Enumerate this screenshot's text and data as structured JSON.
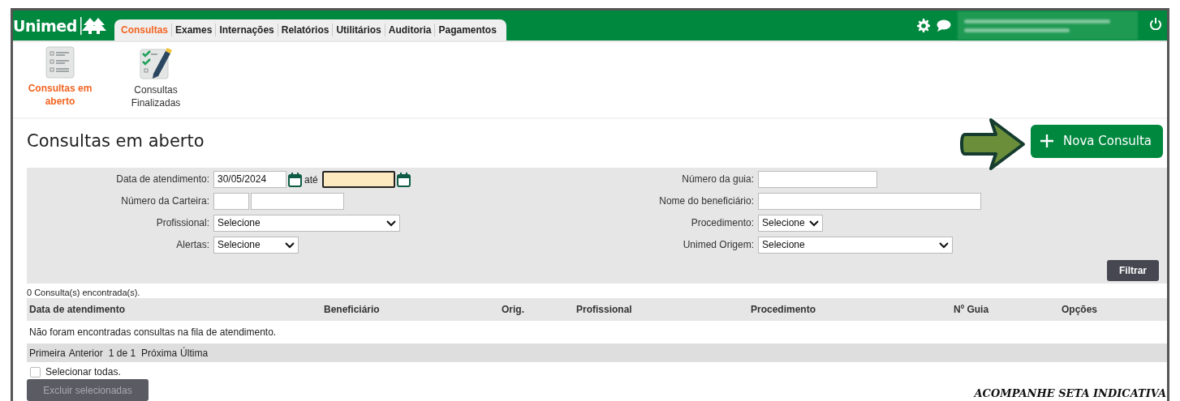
{
  "header": {
    "logo": "Unimed",
    "tabs": [
      {
        "label": "Consultas",
        "selected": true
      },
      {
        "label": "Exames",
        "selected": false
      },
      {
        "label": "Internações",
        "selected": false
      },
      {
        "label": "Relatórios",
        "selected": false
      },
      {
        "label": "Utilitários",
        "selected": false
      },
      {
        "label": "Auditoria",
        "selected": false
      },
      {
        "label": "Pagamentos",
        "selected": false
      }
    ]
  },
  "subnav": [
    {
      "label": "Consultas em aberto",
      "kind": "open",
      "selected": true
    },
    {
      "label": "Consultas Finalizadas",
      "kind": "done",
      "selected": false
    }
  ],
  "page_title": "Consultas em aberto",
  "new_button": "Nova Consulta",
  "filters": {
    "left": [
      {
        "label": "Data de atendimento:",
        "kind": "daterange",
        "value": "30/05/2024",
        "separator": "até",
        "end_focused": true
      },
      {
        "label": "Número da Carteira:",
        "kind": "split"
      },
      {
        "label": "Profissional:",
        "kind": "select",
        "value": "Selecione"
      },
      {
        "label": "Alertas:",
        "kind": "select",
        "value": "Selecione"
      }
    ],
    "right": [
      {
        "label": "Número da guia:",
        "kind": "text"
      },
      {
        "label": "Nome do beneficiário:",
        "kind": "text"
      },
      {
        "label": "Procedimento:",
        "kind": "select",
        "value": "Selecione"
      },
      {
        "label": "Unimed Origem:",
        "kind": "select",
        "value": "Selecione"
      }
    ],
    "submit": "Filtrar"
  },
  "result_count": "0 Consulta(s) encontrada(s).",
  "table": {
    "columns": [
      "Data de atendimento",
      "Beneficiário",
      "Orig.",
      "Profissional",
      "Procedimento",
      "Nº Guia",
      "Opções"
    ],
    "empty_message": "Não foram encontradas consultas na fila de atendimento.",
    "pager": [
      "Primeira",
      "Anterior",
      "1 de 1",
      "Próxima",
      "Última"
    ]
  },
  "select_all": {
    "label": "Selecionar todas.",
    "checked": false
  },
  "delete_button": {
    "label": "Excluir selecionadas",
    "disabled": true
  },
  "annotation": "ACOMPANHE SETA INDICATIVA"
}
